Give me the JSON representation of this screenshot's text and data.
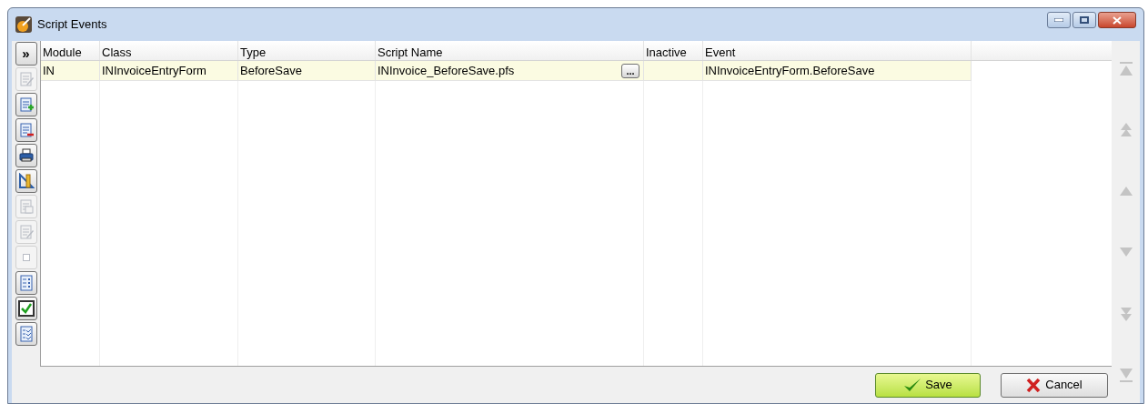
{
  "window": {
    "title": "Script Events"
  },
  "toolbar": [
    {
      "kind": "expand",
      "label": "»",
      "disabled": false
    },
    {
      "kind": "edit",
      "disabled": true
    },
    {
      "kind": "add",
      "disabled": false
    },
    {
      "kind": "delete",
      "disabled": false
    },
    {
      "kind": "print",
      "disabled": false
    },
    {
      "kind": "ruler",
      "disabled": false
    },
    {
      "kind": "copy",
      "disabled": true
    },
    {
      "kind": "note",
      "disabled": true
    },
    {
      "kind": "blank",
      "disabled": true
    },
    {
      "kind": "list",
      "disabled": false
    },
    {
      "kind": "check",
      "disabled": false
    },
    {
      "kind": "checklist",
      "disabled": false
    }
  ],
  "table": {
    "columns": [
      "Module",
      "Class",
      "Type",
      "Script Name",
      "Inactive",
      "Event"
    ],
    "rows": [
      {
        "selected": true,
        "cells": [
          "IN",
          "INInvoiceEntryForm",
          "BeforeSave",
          "INInvoice_BeforeSave.pfs",
          "",
          "INInvoiceEntryForm.BeforeSave"
        ],
        "browse_button": "..."
      }
    ]
  },
  "navigation": [
    {
      "kind": "first",
      "disabled": true
    },
    {
      "kind": "page-up",
      "disabled": true
    },
    {
      "kind": "up",
      "disabled": true
    },
    {
      "kind": "down",
      "disabled": true
    },
    {
      "kind": "page-down",
      "disabled": true
    },
    {
      "kind": "last",
      "disabled": true
    }
  ],
  "buttons": [
    {
      "kind": "save",
      "label": "Save"
    },
    {
      "kind": "cancel",
      "label": "Cancel"
    }
  ]
}
